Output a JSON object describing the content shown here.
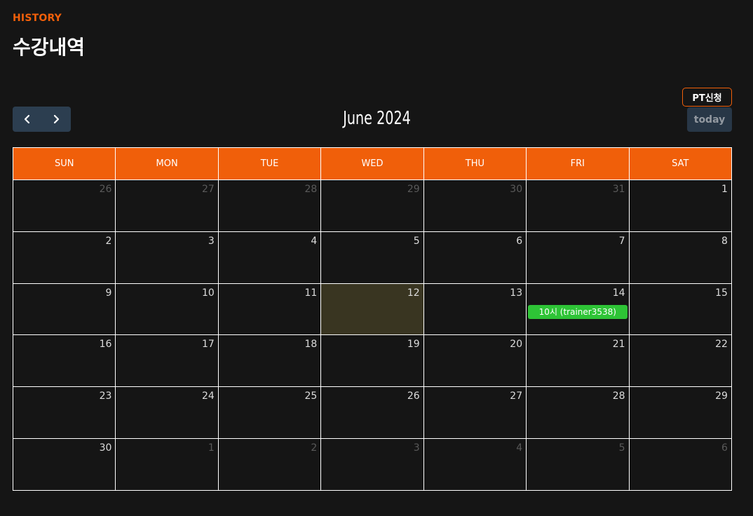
{
  "header": {
    "eyebrow": "HISTORY",
    "title": "수강내역"
  },
  "toolbar": {
    "pt_button_label": "PT신청",
    "title": "June 2024",
    "today_label": "today",
    "prev_icon": "chevron-left-icon",
    "next_icon": "chevron-right-icon"
  },
  "colors": {
    "accent": "#f05f0a",
    "nav_bg": "#2c3e50",
    "today_highlight": "#393521",
    "event_bg": "#2ec436"
  },
  "calendar": {
    "weekdays": [
      "SUN",
      "MON",
      "TUE",
      "WED",
      "THU",
      "FRI",
      "SAT"
    ],
    "weeks": [
      [
        {
          "d": "26",
          "other": true
        },
        {
          "d": "27",
          "other": true
        },
        {
          "d": "28",
          "other": true
        },
        {
          "d": "29",
          "other": true
        },
        {
          "d": "30",
          "other": true
        },
        {
          "d": "31",
          "other": true
        },
        {
          "d": "1"
        }
      ],
      [
        {
          "d": "2"
        },
        {
          "d": "3"
        },
        {
          "d": "4"
        },
        {
          "d": "5"
        },
        {
          "d": "6"
        },
        {
          "d": "7"
        },
        {
          "d": "8"
        }
      ],
      [
        {
          "d": "9"
        },
        {
          "d": "10"
        },
        {
          "d": "11"
        },
        {
          "d": "12",
          "today": true
        },
        {
          "d": "13"
        },
        {
          "d": "14",
          "event": "10시 (trainer3538)"
        },
        {
          "d": "15"
        }
      ],
      [
        {
          "d": "16"
        },
        {
          "d": "17"
        },
        {
          "d": "18"
        },
        {
          "d": "19"
        },
        {
          "d": "20"
        },
        {
          "d": "21"
        },
        {
          "d": "22"
        }
      ],
      [
        {
          "d": "23"
        },
        {
          "d": "24"
        },
        {
          "d": "25"
        },
        {
          "d": "26"
        },
        {
          "d": "27"
        },
        {
          "d": "28"
        },
        {
          "d": "29"
        }
      ],
      [
        {
          "d": "30"
        },
        {
          "d": "1",
          "other": true
        },
        {
          "d": "2",
          "other": true
        },
        {
          "d": "3",
          "other": true
        },
        {
          "d": "4",
          "other": true
        },
        {
          "d": "5",
          "other": true
        },
        {
          "d": "6",
          "other": true
        }
      ]
    ]
  }
}
